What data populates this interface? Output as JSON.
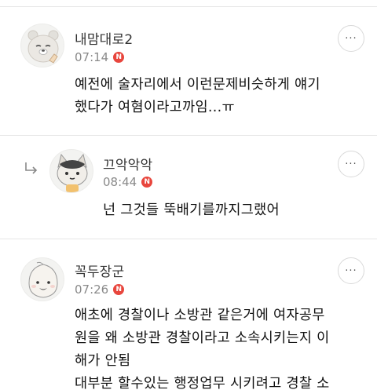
{
  "comments": [
    {
      "author": "내맘대로2",
      "time": "07:14",
      "badge": "N",
      "text": "예전에 술자리에서 이런문제비슷하게 얘기\n했다가 여혐이라고까임...ㅠ",
      "more": "···",
      "icon": "avatar-bear-icon"
    },
    {
      "author": "끄악악악",
      "time": "08:44",
      "badge": "N",
      "text": "넌 그것들 뚝배기를까지그랬어",
      "more": "···",
      "icon": "avatar-cat-icon",
      "reply_icon": "reply-arrow-icon"
    },
    {
      "author": "꼭두장군",
      "time": "07:26",
      "badge": "N",
      "text": "애초에 경찰이나 소방관 같은거에 여자공무\n원을 왜 소방관 경찰이라고 소속시키는지 이\n해가 안됨\n대부분 할수있는 행정업무 시키려고 경찰 소",
      "more": "···",
      "icon": "avatar-peach-icon"
    }
  ],
  "colors": {
    "badge": "#e8463d",
    "time": "#8a8a8a",
    "divider": "#e6e6e6"
  }
}
